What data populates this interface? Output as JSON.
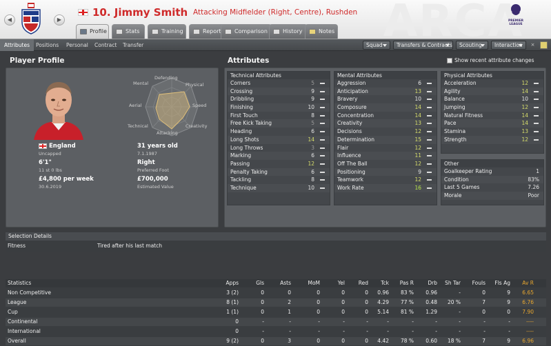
{
  "header": {
    "player_title": "10. Jimmy Smith",
    "subtitle": "Attacking Midfielder (Right, Centre), Rushden",
    "watermark": "ARCA",
    "league_logo_text": "PREMIER LEAGUE"
  },
  "tabs": [
    {
      "label": "Profile",
      "active": true
    },
    {
      "label": "Stats"
    },
    {
      "label": "Training"
    },
    {
      "label": "Reports"
    },
    {
      "label": "Comparison"
    },
    {
      "label": "History"
    },
    {
      "label": "Notes"
    }
  ],
  "subnav": {
    "items": [
      "Attributes",
      "Positions",
      "Personal",
      "Contract",
      "Transfer"
    ],
    "dropdowns": [
      "Squad",
      "Transfers & Contracts",
      "Scouting",
      "Interaction"
    ],
    "close": "×"
  },
  "profile": {
    "section_title": "Player Profile",
    "radar_labels": {
      "top": "Defending",
      "tr": "Physical",
      "r": "Speed",
      "br": "Creativity",
      "b": "Attacking",
      "bl": "Technical",
      "l": "Aerial",
      "tl": "Mental"
    },
    "nationality": "England",
    "caps": "Uncapped",
    "age": "31 years old",
    "dob": "7.1.1987",
    "height": "6'1\"",
    "weight": "11 st 0 lbs",
    "foot": "Right",
    "foot_label": "Preferred Foot",
    "wage": "£4,800 per week",
    "contract_end": "30.6.2019",
    "value": "£700,000",
    "value_label": "Estimated Value"
  },
  "attributes": {
    "section_title": "Attributes",
    "show_recent_label": "Show recent attribute changes",
    "technical": {
      "title": "Technical Attributes",
      "items": [
        [
          "Corners",
          "5"
        ],
        [
          "Crossing",
          "9"
        ],
        [
          "Dribbling",
          "9"
        ],
        [
          "Finishing",
          "10"
        ],
        [
          "First Touch",
          "8"
        ],
        [
          "Free Kick Taking",
          "5"
        ],
        [
          "Heading",
          "6"
        ],
        [
          "Long Shots",
          "14"
        ],
        [
          "Long Throws",
          "3"
        ],
        [
          "Marking",
          "6"
        ],
        [
          "Passing",
          "12"
        ],
        [
          "Penalty Taking",
          "6"
        ],
        [
          "Tackling",
          "8"
        ],
        [
          "Technique",
          "10"
        ]
      ]
    },
    "mental": {
      "title": "Mental Attributes",
      "items": [
        [
          "Aggression",
          "6"
        ],
        [
          "Anticipation",
          "13"
        ],
        [
          "Bravery",
          "10"
        ],
        [
          "Composure",
          "14"
        ],
        [
          "Concentration",
          "14"
        ],
        [
          "Creativity",
          "13"
        ],
        [
          "Decisions",
          "12"
        ],
        [
          "Determination",
          "15"
        ],
        [
          "Flair",
          "12"
        ],
        [
          "Influence",
          "11"
        ],
        [
          "Off The Ball",
          "12"
        ],
        [
          "Positioning",
          "9"
        ],
        [
          "Teamwork",
          "12"
        ],
        [
          "Work Rate",
          "16"
        ]
      ]
    },
    "physical": {
      "title": "Physical Attributes",
      "items": [
        [
          "Acceleration",
          "12"
        ],
        [
          "Agility",
          "14"
        ],
        [
          "Balance",
          "10"
        ],
        [
          "Jumping",
          "12"
        ],
        [
          "Natural Fitness",
          "14"
        ],
        [
          "Pace",
          "14"
        ],
        [
          "Stamina",
          "13"
        ],
        [
          "Strength",
          "12"
        ]
      ]
    },
    "other": {
      "title": "Other",
      "items": [
        [
          "Goalkeeper Rating",
          "1"
        ],
        [
          "Condition",
          "83%"
        ],
        [
          "Last 5 Games",
          "7.26"
        ],
        [
          "Morale",
          "Poor"
        ]
      ]
    }
  },
  "selection": {
    "title": "Selection Details",
    "fitness_label": "Fitness",
    "fitness_value": "Tired after his last match"
  },
  "stats": {
    "headers": [
      "Statistics",
      "Apps",
      "Gls",
      "Asts",
      "MoM",
      "Yel",
      "Red",
      "Tck",
      "Pas R",
      "Drb",
      "Sh Tar",
      "Fouls",
      "Fls Ag",
      "Av R"
    ],
    "rows": [
      [
        "Non Competitive",
        "3 (2)",
        "0",
        "0",
        "0",
        "0",
        "0",
        "0.96",
        "83 %",
        "0.96",
        "-",
        "0",
        "9",
        "6.65"
      ],
      [
        "League",
        "8 (1)",
        "0",
        "2",
        "0",
        "0",
        "0",
        "4.29",
        "77 %",
        "0.48",
        "20 %",
        "7",
        "9",
        "6.76"
      ],
      [
        "Cup",
        "1 (1)",
        "0",
        "1",
        "0",
        "0",
        "0",
        "5.14",
        "81 %",
        "1.29",
        "-",
        "0",
        "0",
        "7.90"
      ],
      [
        "Continental",
        "0",
        "-",
        "-",
        "-",
        "-",
        "-",
        "-",
        "-",
        "-",
        "-",
        "-",
        "-",
        "----"
      ],
      [
        "International",
        "0",
        "-",
        "-",
        "-",
        "-",
        "-",
        "-",
        "-",
        "-",
        "-",
        "-",
        "-",
        "----"
      ],
      [
        "Overall",
        "9 (2)",
        "0",
        "3",
        "0",
        "0",
        "0",
        "4.42",
        "78 %",
        "0.60",
        "18 %",
        "7",
        "9",
        "6.96"
      ]
    ]
  }
}
